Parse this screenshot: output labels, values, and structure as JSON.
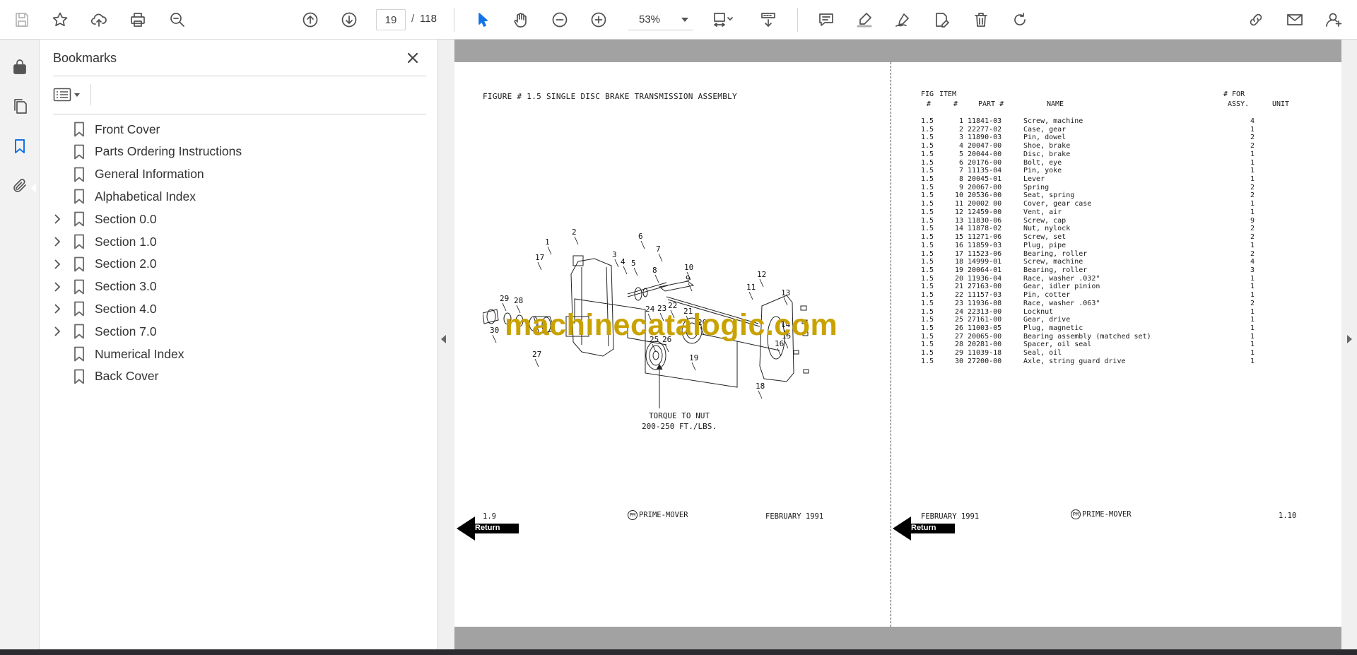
{
  "toolbar": {
    "page_current": "19",
    "page_separator": "/",
    "page_total": "118",
    "zoom": "53%"
  },
  "bookmarks": {
    "title": "Bookmarks",
    "items": [
      {
        "label": "Front Cover",
        "expandable": false
      },
      {
        "label": "Parts Ordering Instructions",
        "expandable": false
      },
      {
        "label": "General Information",
        "expandable": false
      },
      {
        "label": "Alphabetical Index",
        "expandable": false
      },
      {
        "label": "Section 0.0",
        "expandable": true
      },
      {
        "label": "Section 1.0",
        "expandable": true
      },
      {
        "label": "Section 2.0",
        "expandable": true
      },
      {
        "label": "Section 3.0",
        "expandable": true
      },
      {
        "label": "Section 4.0",
        "expandable": true
      },
      {
        "label": "Section 7.0",
        "expandable": true
      },
      {
        "label": "Numerical Index",
        "expandable": false
      },
      {
        "label": "Back Cover",
        "expandable": false
      }
    ]
  },
  "left_page": {
    "figure_title": "FIGURE # 1.5 SINGLE DISC BRAKE TRANSMISSION ASSEMBLY",
    "torque_line1": "TORQUE TO NUT",
    "torque_line2": "200-250 FT./LBS.",
    "callouts": [
      "1",
      "2",
      "3",
      "4",
      "5",
      "6",
      "7",
      "8",
      "9",
      "10",
      "11",
      "12",
      "13",
      "14",
      "15",
      "16",
      "17",
      "18",
      "19",
      "20",
      "21",
      "22",
      "23",
      "24",
      "25",
      "26",
      "27",
      "28",
      "29",
      "30"
    ],
    "footer_page": "1.9",
    "footer_brand": "PRIME-MOVER",
    "footer_logo": "PM",
    "footer_date": "FEBRUARY 1991",
    "return_label": "Return"
  },
  "right_page": {
    "headers": {
      "fig_top": "FIG",
      "item_top": "ITEM",
      "fig": "#",
      "item": "#",
      "part": "PART #",
      "name": "NAME",
      "for_top": "# FOR",
      "assy": "ASSY.",
      "unit": "UNIT"
    },
    "rows": [
      {
        "fig": "1.5",
        "item": "1",
        "part": "11841-03",
        "name": "Screw, machine",
        "qty": "4"
      },
      {
        "fig": "1.5",
        "item": "2",
        "part": "22277-02",
        "name": "Case, gear",
        "qty": "1"
      },
      {
        "fig": "1.5",
        "item": "3",
        "part": "11890-03",
        "name": "Pin, dowel",
        "qty": "2"
      },
      {
        "fig": "1.5",
        "item": "4",
        "part": "20047-00",
        "name": "Shoe, brake",
        "qty": "2"
      },
      {
        "fig": "1.5",
        "item": "5",
        "part": "20044-00",
        "name": "Disc, brake",
        "qty": "1"
      },
      {
        "fig": "1.5",
        "item": "6",
        "part": "20176-00",
        "name": "Bolt, eye",
        "qty": "1"
      },
      {
        "fig": "1.5",
        "item": "7",
        "part": "11135-04",
        "name": "Pin, yoke",
        "qty": "1"
      },
      {
        "fig": "1.5",
        "item": "8",
        "part": "20045-01",
        "name": "Lever",
        "qty": "1"
      },
      {
        "fig": "1.5",
        "item": "9",
        "part": "20067-00",
        "name": "Spring",
        "qty": "2"
      },
      {
        "fig": "1.5",
        "item": "10",
        "part": "20536-00",
        "name": "Seat, spring",
        "qty": "2"
      },
      {
        "fig": "1.5",
        "item": "11",
        "part": "20002 00",
        "name": "Cover, gear case",
        "qty": "1"
      },
      {
        "fig": "1.5",
        "item": "12",
        "part": "12459-00",
        "name": "Vent, air",
        "qty": "1"
      },
      {
        "fig": "1.5",
        "item": "13",
        "part": "11830-06",
        "name": "Screw, cap",
        "qty": "9"
      },
      {
        "fig": "1.5",
        "item": "14",
        "part": "11878-02",
        "name": "Nut, nylock",
        "qty": "2"
      },
      {
        "fig": "1.5",
        "item": "15",
        "part": "11271-06",
        "name": "Screw, set",
        "qty": "2"
      },
      {
        "fig": "1.5",
        "item": "16",
        "part": "11859-03",
        "name": "Plug, pipe",
        "qty": "1"
      },
      {
        "fig": "1.5",
        "item": "17",
        "part": "11523-06",
        "name": "Bearing, roller",
        "qty": "2"
      },
      {
        "fig": "1.5",
        "item": "18",
        "part": "14999-01",
        "name": "Screw, machine",
        "qty": "4"
      },
      {
        "fig": "1.5",
        "item": "19",
        "part": "20064-01",
        "name": "Bearing, roller",
        "qty": "3"
      },
      {
        "fig": "1.5",
        "item": "20",
        "part": "11936-04",
        "name": "Race, washer .032\"",
        "qty": "1"
      },
      {
        "fig": "1.5",
        "item": "21",
        "part": "27163-00",
        "name": "Gear, idler pinion",
        "qty": "1"
      },
      {
        "fig": "1.5",
        "item": "22",
        "part": "11157-03",
        "name": "Pin, cotter",
        "qty": "1"
      },
      {
        "fig": "1.5",
        "item": "23",
        "part": "11936-08",
        "name": "Race, washer .063\"",
        "qty": "2"
      },
      {
        "fig": "1.5",
        "item": "24",
        "part": "22313-00",
        "name": "Locknut",
        "qty": "1"
      },
      {
        "fig": "1.5",
        "item": "25",
        "part": "27161-00",
        "name": "Gear, drive",
        "qty": "1"
      },
      {
        "fig": "1.5",
        "item": "26",
        "part": "11003-05",
        "name": "Plug, magnetic",
        "qty": "1"
      },
      {
        "fig": "1.5",
        "item": "27",
        "part": "20065-00",
        "name": "Bearing assembly (matched set)",
        "qty": "1"
      },
      {
        "fig": "1.5",
        "item": "28",
        "part": "20281-00",
        "name": "Spacer, oil seal",
        "qty": "1"
      },
      {
        "fig": "1.5",
        "item": "29",
        "part": "11039-18",
        "name": "Seal, oil",
        "qty": "1"
      },
      {
        "fig": "1.5",
        "item": "30",
        "part": "27200-00",
        "name": "Axle, string guard drive",
        "qty": "1"
      }
    ],
    "footer_date": "FEBRUARY 1991",
    "footer_brand": "PRIME-MOVER",
    "footer_logo": "PM",
    "footer_page": "1.10",
    "return_label": "Return"
  },
  "watermark": "machinecatalogic.com",
  "colors": {
    "accent": "#1473e6",
    "watermark": "#c9a200",
    "band": "#a2a2a2"
  },
  "icons": {
    "toolbar": [
      "save-icon",
      "star-icon",
      "upload-icon",
      "print-icon",
      "find-zoom-icon",
      "page-up-icon",
      "page-down-icon",
      "select-arrow-icon",
      "hand-icon",
      "zoom-out-icon",
      "zoom-in-icon",
      "fit-page-icon",
      "scroll-mode-icon",
      "comment-icon",
      "highlight-icon",
      "sign-icon",
      "fill-sign-icon",
      "delete-icon",
      "rotate-icon",
      "share-link-icon",
      "email-icon",
      "account-icon"
    ],
    "rail": [
      "lock-icon",
      "pages-icon",
      "bookmark-icon",
      "attachment-icon"
    ]
  }
}
